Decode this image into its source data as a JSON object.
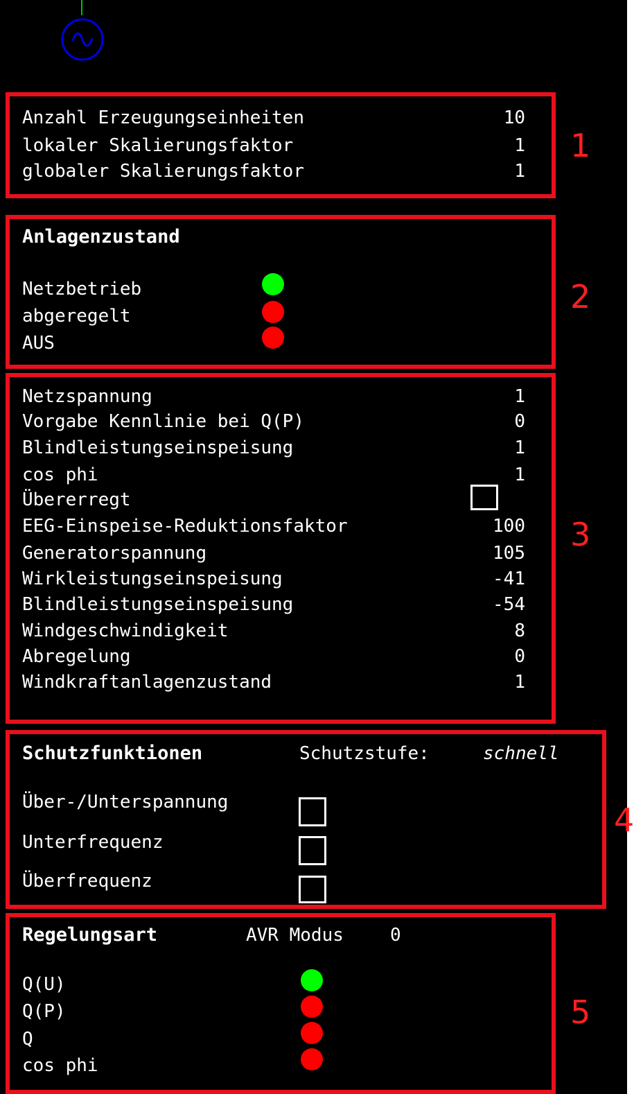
{
  "colors": {
    "background": "#000000",
    "frame": "#e8101c",
    "section_number": "#ff2020",
    "status_on": "#00ff00",
    "status_off": "#ff0000",
    "generator": "#0000dd"
  },
  "icons": {
    "generator": "ac-generator-icon"
  },
  "section1": {
    "number": "1",
    "rows": [
      {
        "label": "Anzahl Erzeugungseinheiten",
        "value": "10"
      },
      {
        "label": "lokaler Skalierungsfaktor",
        "value": "1"
      },
      {
        "label": "globaler Skalierungsfaktor",
        "value": "1"
      }
    ]
  },
  "section2": {
    "number": "2",
    "title": "Anlagenzustand",
    "states": [
      {
        "label": "Netzbetrieb",
        "active": true
      },
      {
        "label": "abgeregelt",
        "active": false
      },
      {
        "label": "AUS",
        "active": false
      }
    ]
  },
  "section3": {
    "number": "3",
    "rows": [
      {
        "label": "Netzspannung",
        "value": "1"
      },
      {
        "label": "Vorgabe Kennlinie bei Q(P)",
        "value": "0"
      },
      {
        "label": "Blindleistungseinspeisung",
        "value": "1"
      },
      {
        "label": "cos phi",
        "value": "1"
      },
      {
        "label": "Übererregt",
        "checked": false
      },
      {
        "label": "EEG-Einspeise-Reduktionsfaktor",
        "value": "100"
      },
      {
        "label": "Generatorspannung",
        "value": "105"
      },
      {
        "label": "Wirkleistungseinspeisung",
        "value": "-41"
      },
      {
        "label": "Blindleistungseinspeisung",
        "value": "-54"
      },
      {
        "label": "Windgeschwindigkeit",
        "value": "8"
      },
      {
        "label": "Abregelung",
        "value": "0"
      },
      {
        "label": "Windkraftanlagenzustand",
        "value": "1"
      }
    ]
  },
  "section4": {
    "number": "4",
    "title": "Schutzfunktionen",
    "level_label": "Schutzstufe:",
    "level_value": "schnell",
    "items": [
      {
        "label": "Über-/Unterspannung",
        "checked": false
      },
      {
        "label": "Unterfrequenz",
        "checked": false
      },
      {
        "label": "Überfrequenz",
        "checked": false
      }
    ]
  },
  "section5": {
    "number": "5",
    "title": "Regelungsart",
    "mode_label": "AVR Modus",
    "mode_value": "0",
    "modes": [
      {
        "label": "Q(U)",
        "active": true
      },
      {
        "label": "Q(P)",
        "active": false
      },
      {
        "label": "Q",
        "active": false
      },
      {
        "label": "cos phi",
        "active": false
      }
    ]
  }
}
